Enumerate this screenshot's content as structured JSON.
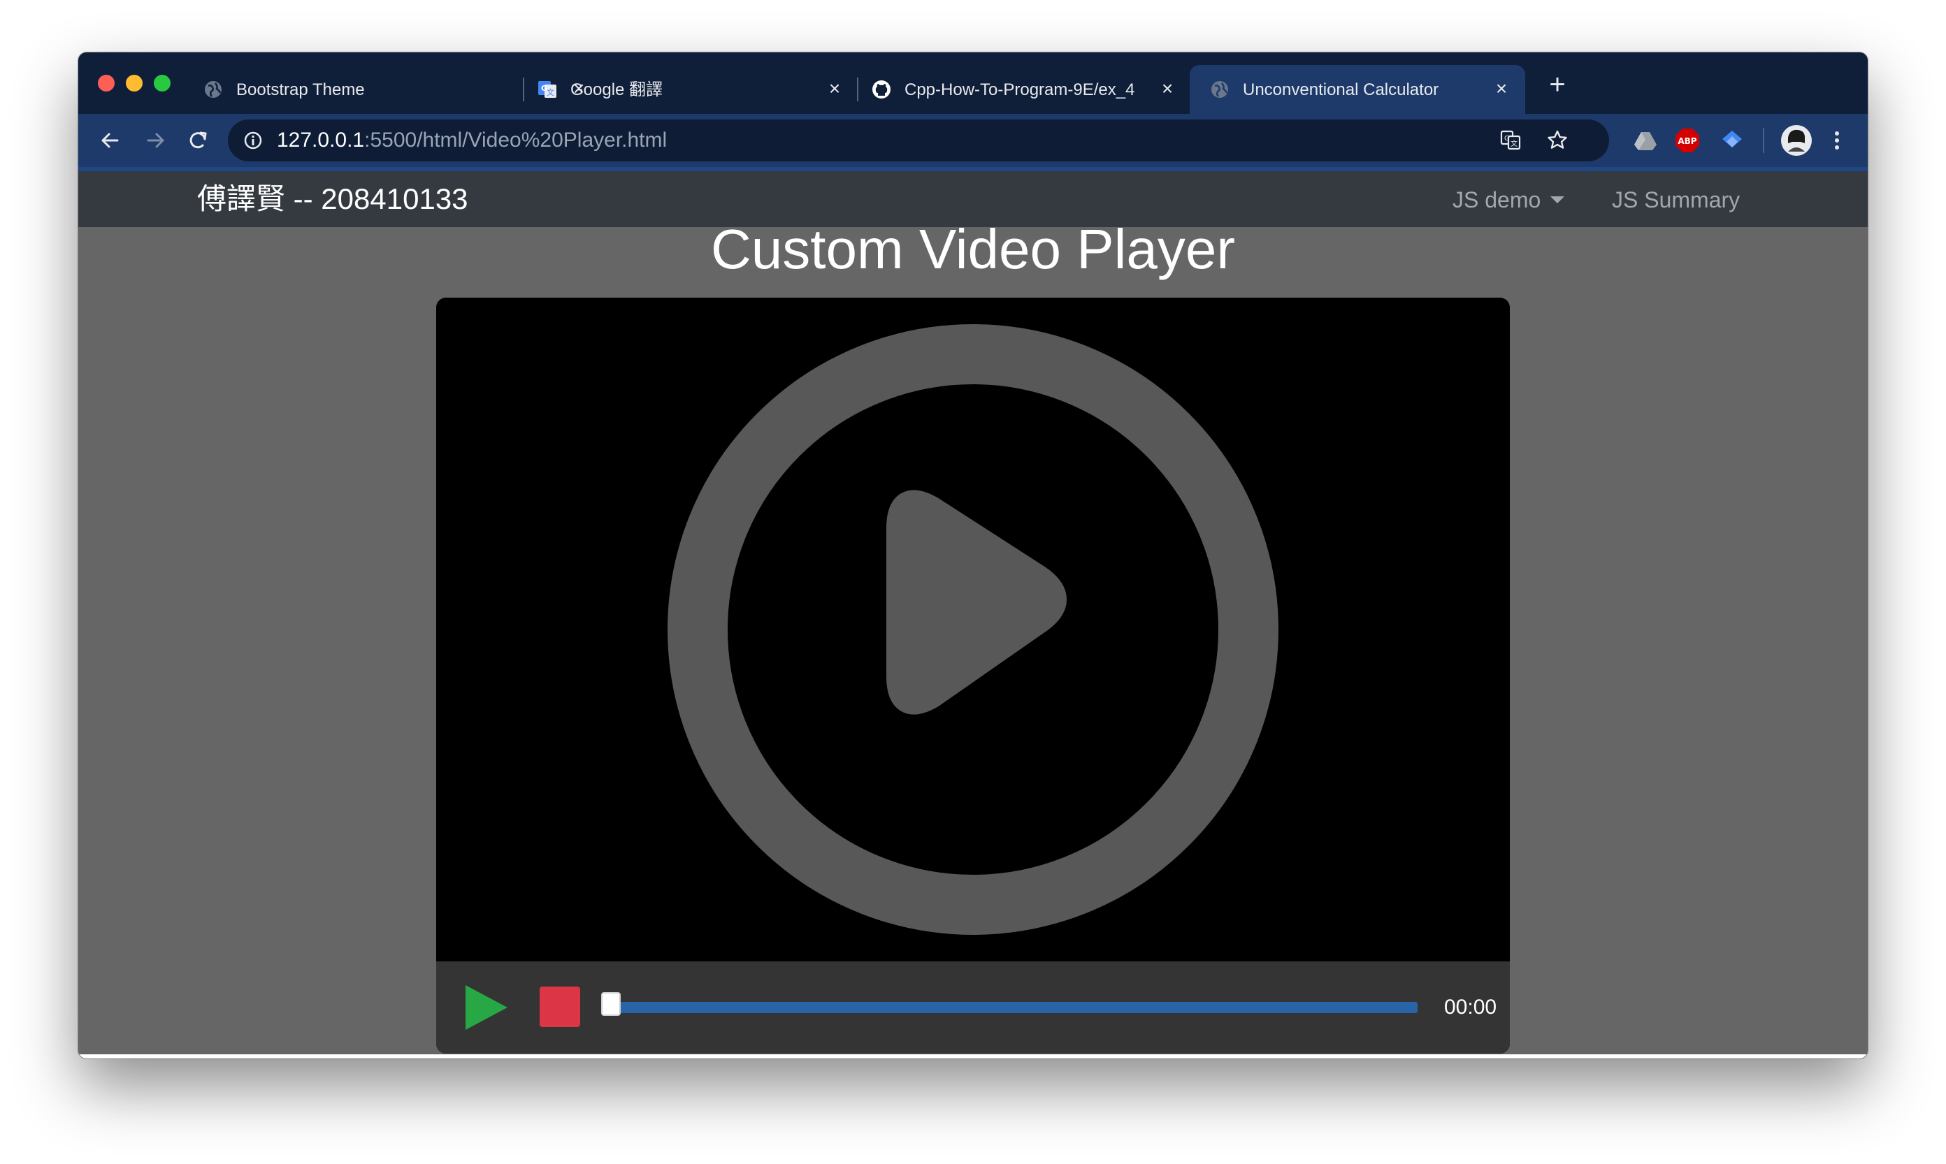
{
  "browser": {
    "tabs": [
      {
        "title": "Bootstrap Theme",
        "favicon": "globe-icon",
        "active": false
      },
      {
        "title": "Google 翻譯",
        "favicon": "google-translate-icon",
        "active": false
      },
      {
        "title": "Cpp-How-To-Program-9E/ex_4",
        "favicon": "github-icon",
        "active": false
      },
      {
        "title": "Unconventional Calculator",
        "favicon": "globe-icon",
        "active": true
      }
    ],
    "close_glyph": "×",
    "new_tab_glyph": "+",
    "url_host": "127.0.0.1",
    "url_rest": ":5500/html/Video%20Player.html",
    "extensions": [
      "google-drive-icon",
      "adblock-plus-icon",
      "extension-icon"
    ],
    "abp_text": "ABP"
  },
  "navbar": {
    "brand": "傅譯賢 -- 208410133",
    "links": [
      {
        "label": "JS demo",
        "dropdown": true
      },
      {
        "label": "JS Summary",
        "dropdown": false
      }
    ]
  },
  "page": {
    "title": "Custom Video Player"
  },
  "player": {
    "time": "00:00",
    "progress": 0,
    "play_color": "#28a745",
    "stop_color": "#dc3545",
    "track_color": "#2a64a8"
  },
  "colors": {
    "titlebar": "#0f1f3a",
    "toolbar": "#1e3a6a",
    "navbar": "#343a40",
    "page_bg": "#666666"
  }
}
